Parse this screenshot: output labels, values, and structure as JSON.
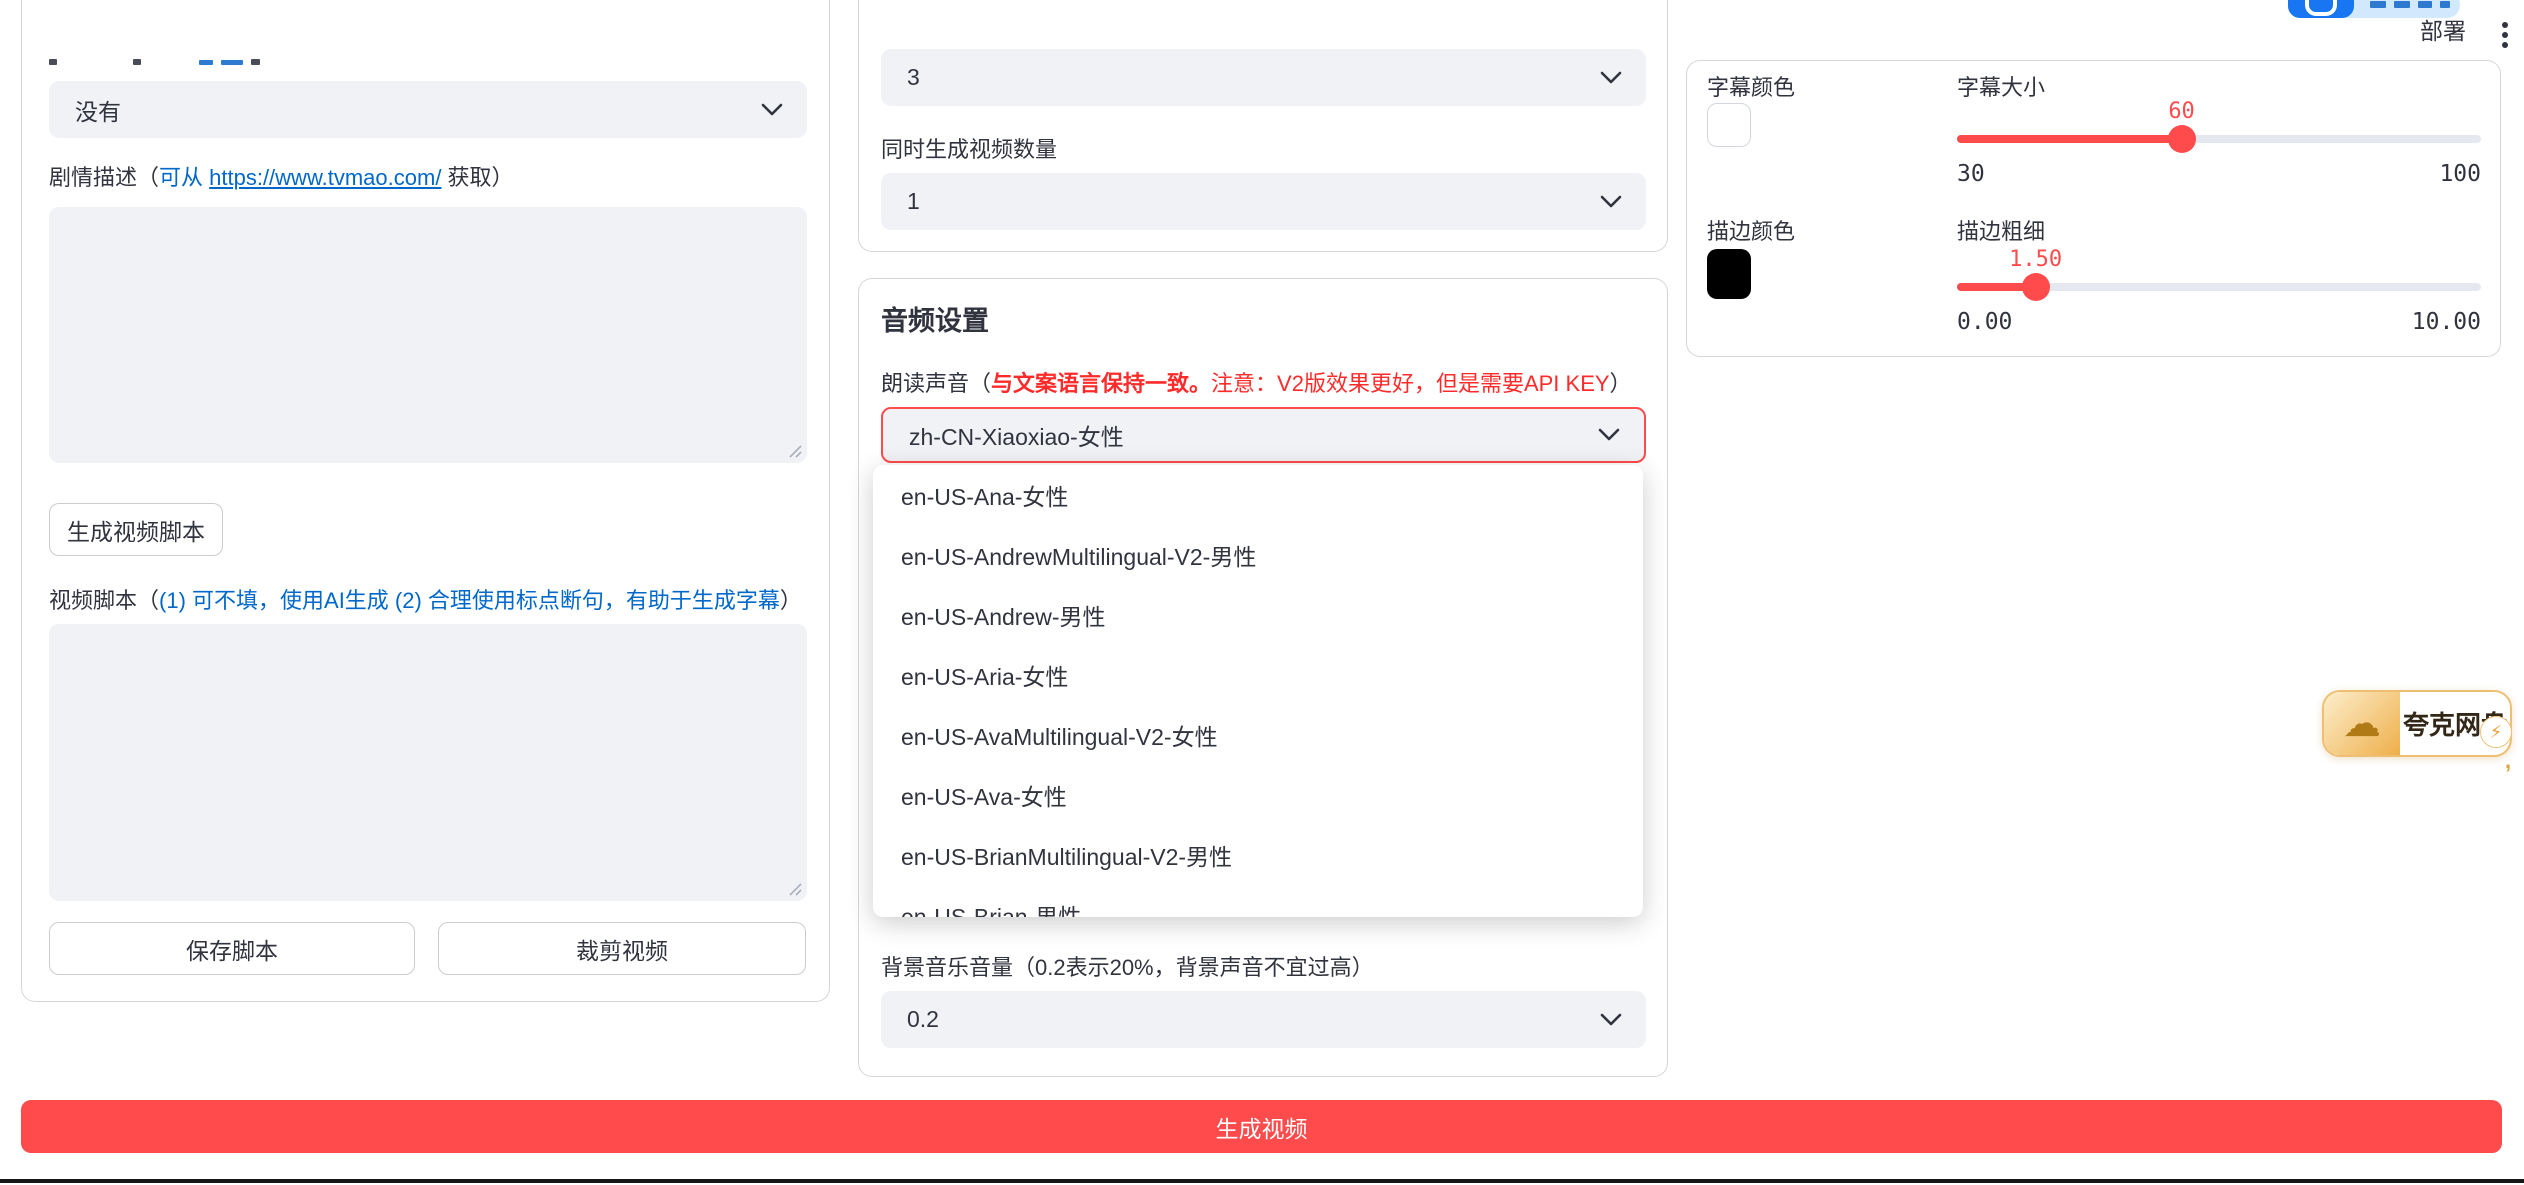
{
  "colors": {
    "accent": "#ff4b4b",
    "link_blue": "#0068c9",
    "note_red": "#ff2b2b",
    "text": "#31333f",
    "field_bg": "#f0f2f6"
  },
  "header": {
    "deploy": "部署"
  },
  "left_panel": {
    "mode_select_value": "没有",
    "plot_label": {
      "pre": "剧情描述（",
      "link_pre": "可从 ",
      "url": "https://www.tvmao.com/",
      "post": " 获取）"
    },
    "generate_script_btn": "生成视频脚本",
    "script_label": {
      "pre": "视频脚本（",
      "hint": "(1) 可不填，使用AI生成 (2) 合理使用标点断句，有助于生成字幕",
      "post": "）"
    },
    "save_btn": "保存脚本",
    "trim_btn": "裁剪视频"
  },
  "middle_panel": {
    "clip_count_value": "3",
    "video_count_label": "同时生成视频数量",
    "video_count_value": "1",
    "audio": {
      "title": "音频设置",
      "voice_label": {
        "pre": "朗读声音（",
        "bold_red": "与文案语言保持一致。",
        "red": "注意：V2版效果更好，但是需要API KEY",
        "post": "）"
      },
      "voice_value": "zh-CN-Xiaoxiao-女性",
      "voice_options": [
        "en-US-Ana-女性",
        "en-US-AndrewMultilingual-V2-男性",
        "en-US-Andrew-男性",
        "en-US-Aria-女性",
        "en-US-AvaMultilingual-V2-女性",
        "en-US-Ava-女性",
        "en-US-BrianMultilingual-V2-男性",
        "en-US-Brian-男性"
      ],
      "bgm_label": "背景音乐音量（0.2表示20%，背景声音不宜过高）",
      "bgm_value": "0.2"
    }
  },
  "generate_btn": "生成视频",
  "right_panel": {
    "subtitle_color_label": "字幕颜色",
    "subtitle_color": "#ffffff",
    "subtitle_size": {
      "label": "字幕大小",
      "value": 60,
      "min": 30,
      "max": 100,
      "value_display": "60",
      "min_display": "30",
      "max_display": "100"
    },
    "stroke_color_label": "描边颜色",
    "stroke_color": "#000000",
    "stroke_width": {
      "label": "描边粗细",
      "value": 1.5,
      "min": 0,
      "max": 10,
      "value_display": "1.50",
      "min_display": "0.00",
      "max_display": "10.00"
    }
  },
  "quark_badge": {
    "text": "夸克网盘"
  }
}
